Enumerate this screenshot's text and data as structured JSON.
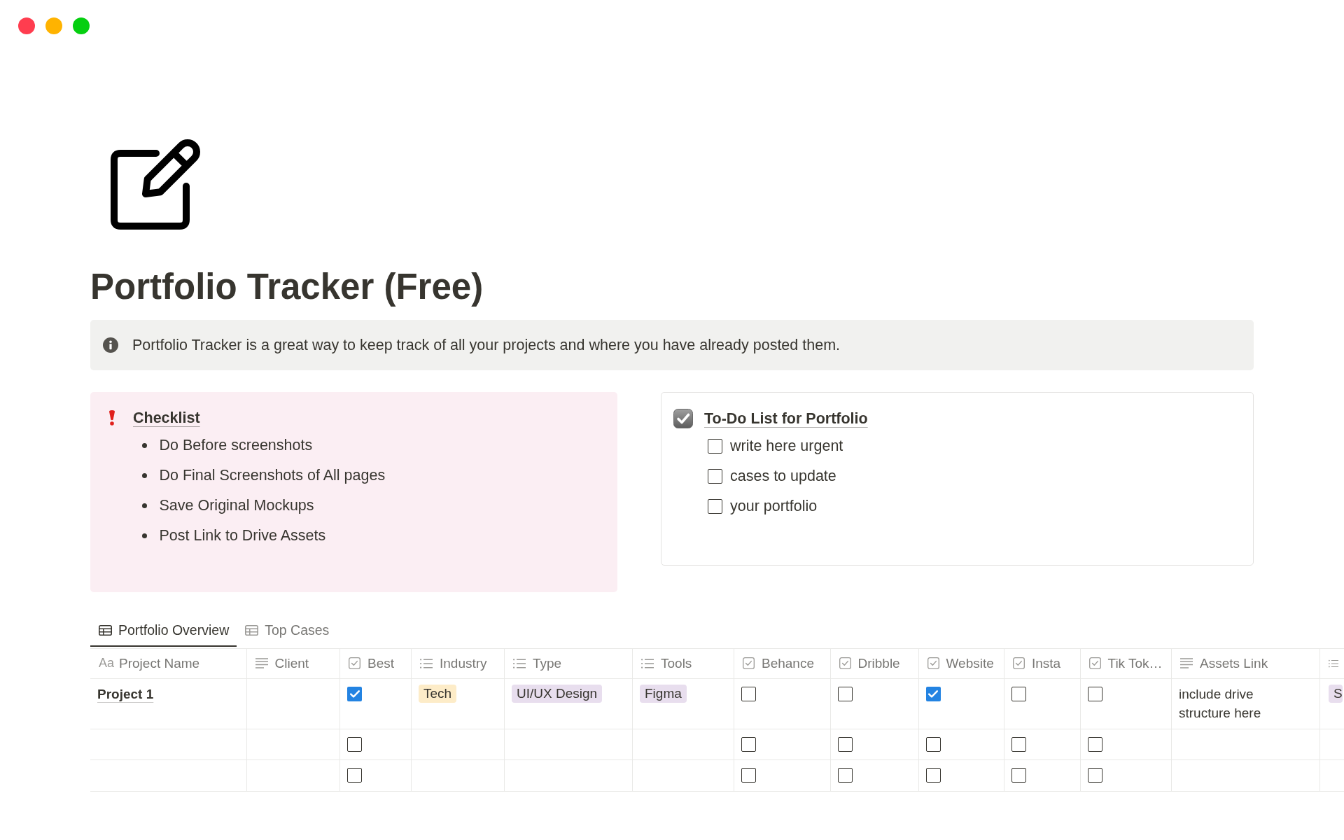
{
  "page": {
    "title": "Portfolio Tracker (Free)"
  },
  "callout": {
    "text": "Portfolio Tracker is a great way to keep track of all your projects and where you have already posted them."
  },
  "checklist": {
    "title": "Checklist",
    "items": [
      "Do Before screenshots",
      "Do Final Screenshots of All pages",
      "Save Original Mockups",
      "Post Link to Drive Assets"
    ]
  },
  "todo": {
    "title": "To-Do List for Portfolio",
    "items": [
      {
        "label": "write here urgent",
        "checked": false
      },
      {
        "label": "cases to update",
        "checked": false
      },
      {
        "label": "your portfolio",
        "checked": false
      }
    ]
  },
  "views": [
    {
      "label": "Portfolio Overview",
      "selected": true
    },
    {
      "label": "Top Cases",
      "selected": false
    }
  ],
  "table": {
    "columns": [
      {
        "kind": "title",
        "icon_text": "Aa",
        "label": "Project Name"
      },
      {
        "kind": "text",
        "label": "Client"
      },
      {
        "kind": "checkbox",
        "label": "Best"
      },
      {
        "kind": "select",
        "label": "Industry"
      },
      {
        "kind": "select",
        "label": "Type"
      },
      {
        "kind": "select",
        "label": "Tools"
      },
      {
        "kind": "checkbox",
        "label": "Behance"
      },
      {
        "kind": "checkbox",
        "label": "Dribble"
      },
      {
        "kind": "checkbox",
        "label": "Website"
      },
      {
        "kind": "checkbox",
        "label": "Insta"
      },
      {
        "kind": "checkbox",
        "label": "Tik Tok…"
      },
      {
        "kind": "text",
        "label": "Assets Link"
      },
      {
        "kind": "select"
      }
    ],
    "rows": [
      {
        "cells": [
          {
            "text": "Project 1"
          },
          {},
          {
            "checked": true
          },
          {
            "tags": [
              {
                "label": "Tech",
                "color": "#fdecc8"
              }
            ]
          },
          {
            "tags": [
              {
                "label": "UI/UX Design",
                "color": "#e8deee"
              }
            ]
          },
          {
            "tags": [
              {
                "label": "Figma",
                "color": "#e8deee"
              }
            ]
          },
          {
            "checked": false
          },
          {
            "checked": false
          },
          {
            "checked": true
          },
          {
            "checked": false
          },
          {
            "checked": false
          },
          {
            "text": "include drive structure here"
          },
          {
            "tags": [
              {
                "label": "S",
                "color": "#e8deee"
              }
            ]
          }
        ]
      },
      {
        "cells": [
          {},
          {},
          {
            "checked": false
          },
          {},
          {},
          {},
          {
            "checked": false
          },
          {
            "checked": false
          },
          {
            "checked": false
          },
          {
            "checked": false
          },
          {
            "checked": false
          },
          {},
          {}
        ]
      },
      {
        "cells": [
          {},
          {},
          {
            "checked": false
          },
          {},
          {},
          {},
          {
            "checked": false
          },
          {
            "checked": false
          },
          {
            "checked": false
          },
          {
            "checked": false
          },
          {
            "checked": false
          },
          {},
          {}
        ]
      }
    ]
  }
}
